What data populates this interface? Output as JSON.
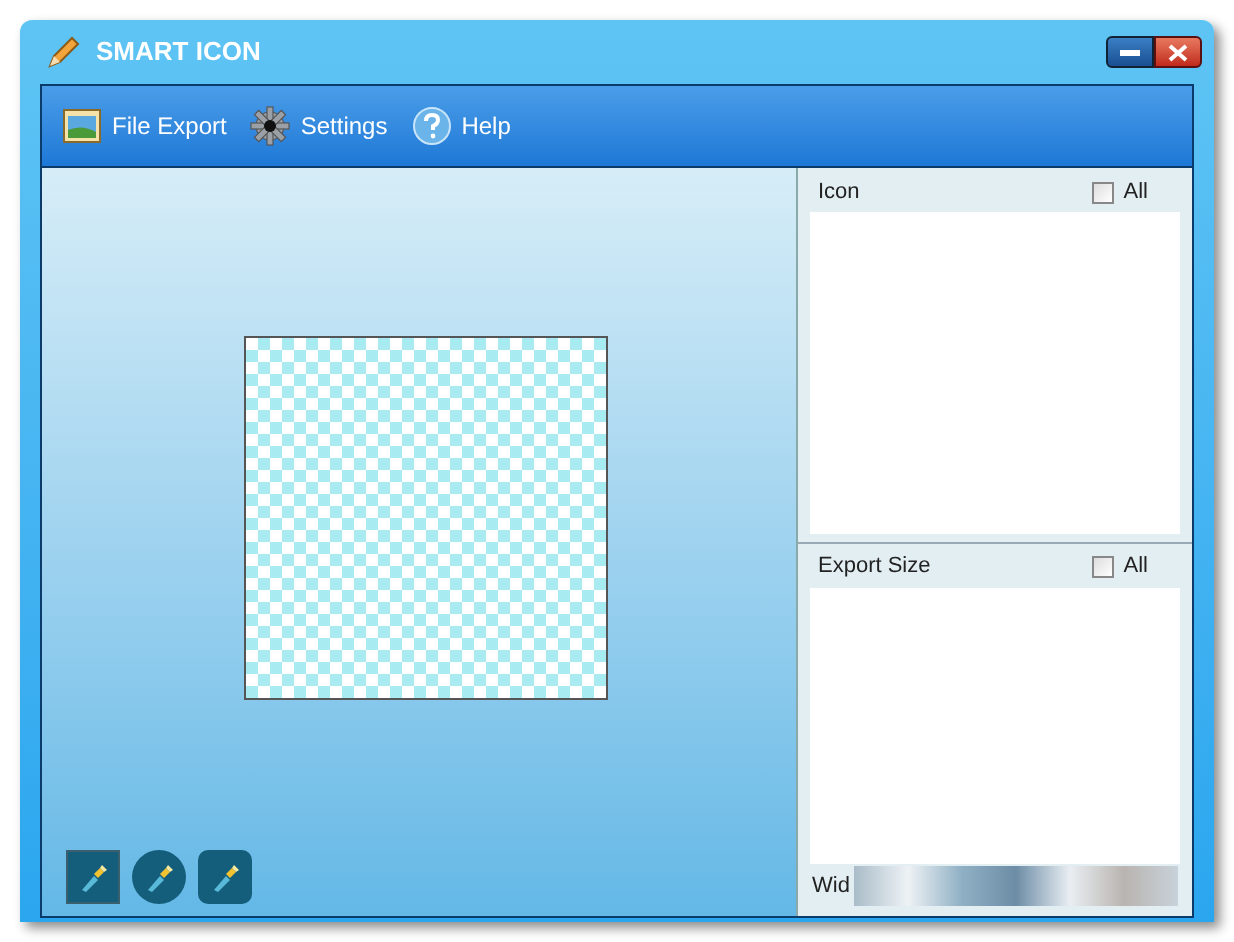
{
  "window": {
    "title": "SMART ICON"
  },
  "toolbar": [
    {
      "label": "File Export",
      "kind": "export"
    },
    {
      "label": "Settings",
      "kind": "settings"
    },
    {
      "label": "Help",
      "kind": "help"
    }
  ],
  "shape_buttons": [
    {
      "kind": "square"
    },
    {
      "kind": "circle"
    },
    {
      "kind": "rounded"
    }
  ],
  "panels": [
    {
      "title": "Icon",
      "all_label": "All",
      "checked": false
    },
    {
      "title": "Export Size",
      "all_label": "All",
      "checked": false
    }
  ],
  "footer_label": "Wid"
}
